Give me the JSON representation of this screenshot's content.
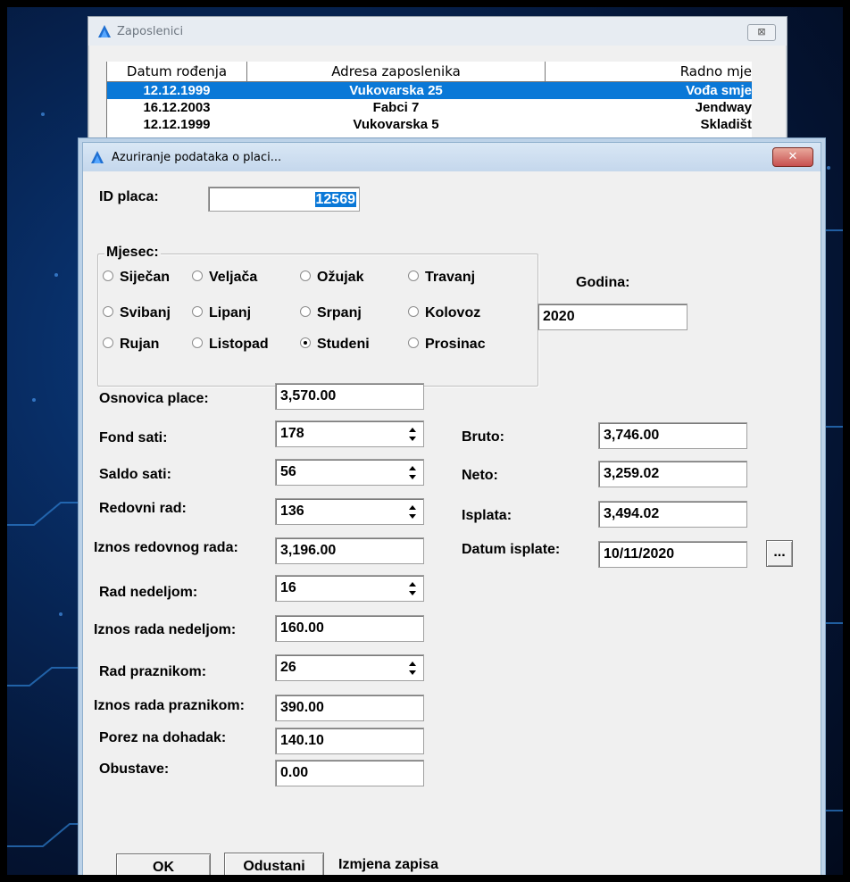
{
  "background_window": {
    "title": "Zaposlenici",
    "close_glyph": "⊠",
    "columns": [
      "Datum rođenja",
      "Adresa zaposlenika",
      "Radno mje"
    ],
    "rows": [
      [
        "12.12.1999",
        "Vukovarska 25",
        "Vođa smje"
      ],
      [
        "16.12.2003",
        "Fabci 7",
        "Jendway"
      ],
      [
        "12.12.1999",
        "Vukovarska 5",
        "Skladišt"
      ]
    ]
  },
  "dialog": {
    "title": "Azuriranje podataka o placi...",
    "close_glyph": "✕",
    "id_label": "ID placa:",
    "id_value": "12569",
    "month_group_label": "Mjesec:",
    "months": [
      {
        "label": "Siječan",
        "checked": false
      },
      {
        "label": "Veljača",
        "checked": false
      },
      {
        "label": "Ožujak",
        "checked": false
      },
      {
        "label": "Travanj",
        "checked": false
      },
      {
        "label": "Svibanj",
        "checked": false
      },
      {
        "label": "Lipanj",
        "checked": false
      },
      {
        "label": "Srpanj",
        "checked": false
      },
      {
        "label": "Kolovoz",
        "checked": false
      },
      {
        "label": "Rujan",
        "checked": false
      },
      {
        "label": "Listopad",
        "checked": false
      },
      {
        "label": "Studeni",
        "checked": true
      },
      {
        "label": "Prosinac",
        "checked": false
      }
    ],
    "year_label": "Godina:",
    "year_value": "2020",
    "left_fields": {
      "osnovica": {
        "label": "Osnovica place:",
        "value": "3,570.00"
      },
      "fond": {
        "label": "Fond sati:",
        "value": "178"
      },
      "saldo": {
        "label": "Saldo sati:",
        "value": "56"
      },
      "redovni": {
        "label": "Redovni rad:",
        "value": "136"
      },
      "iznos_redovnog": {
        "label": "Iznos redovnog rada:",
        "value": "3,196.00"
      },
      "nedeljom": {
        "label": "Rad nedeljom:",
        "value": "16"
      },
      "iznos_nedeljom": {
        "label": "Iznos rada nedeljom:",
        "value": "160.00"
      },
      "praznikom": {
        "label": "Rad praznikom:",
        "value": "26"
      },
      "iznos_praznikom": {
        "label": "Iznos rada praznikom:",
        "value": "390.00"
      },
      "porez": {
        "label": "Porez na dohadak:",
        "value": "140.10"
      },
      "obustave": {
        "label": "Obustave:",
        "value": "0.00"
      }
    },
    "right_fields": {
      "bruto": {
        "label": "Bruto:",
        "value": "3,746.00"
      },
      "neto": {
        "label": "Neto:",
        "value": "3,259.02"
      },
      "isplata": {
        "label": "Isplata:",
        "value": "3,494.02"
      },
      "datum": {
        "label": "Datum isplate:",
        "value": "10/11/2020"
      }
    },
    "date_picker_label": "...",
    "ok_label": "OK",
    "cancel_label": "Odustani",
    "status_text": "Izmjena zapisa"
  },
  "colors": {
    "selection": "#0a78d7",
    "close_button": "#c75050",
    "desktop": "#07295d"
  }
}
